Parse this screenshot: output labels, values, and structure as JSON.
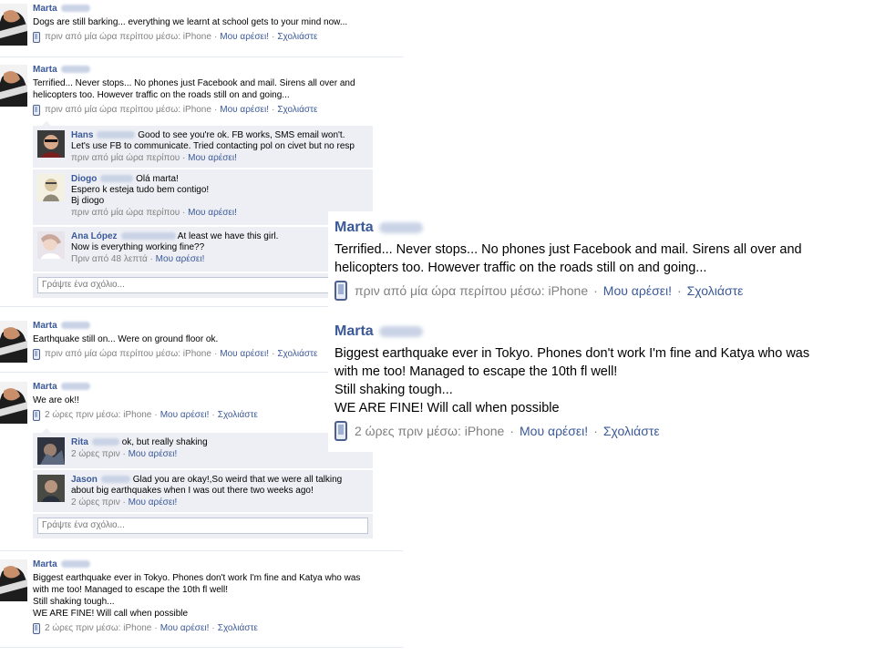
{
  "colors": {
    "link": "#3b5998",
    "meta": "#808080",
    "comment_bg": "#edeff4"
  },
  "feed": {
    "stories": [
      {
        "author": "Marta",
        "text": "Dogs are still barking... everything we learnt at school gets to your mind now...",
        "meta": {
          "time": "πριν από μία ώρα περίπου μέσω: iPhone",
          "like": "Μου αρέσει!",
          "comment": "Σχολιάστε"
        }
      },
      {
        "author": "Marta",
        "text": "Terrified... Never stops... No phones just Facebook and mail. Sirens all over and\nhelicopters too. However traffic on the roads still on and going...",
        "meta": {
          "time": "πριν από μία ώρα περίπου μέσω: iPhone",
          "like": "Μου αρέσει!",
          "comment": "Σχολιάστε"
        },
        "comments": [
          {
            "author": "Hans",
            "text": "Good to see you're ok. FB works, SMS email won't.\nLet's use FB to communicate. Tried contacting pol on civet but no resp",
            "time": "πριν από μία ώρα περίπου",
            "like": "Μου αρέσει!"
          },
          {
            "author": "Diogo",
            "text": "Olá marta!\nEspero k esteja tudo bem contigo!\nBj diogo",
            "time": "πριν από μία ώρα περίπου",
            "like": "Μου αρέσει!"
          },
          {
            "author": "Ana López",
            "text": "At least we have this girl.\nNow is everything working fine??",
            "time": "Πριν από 48 λεπτά",
            "like": "Μου αρέσει!"
          }
        ],
        "write_placeholder": "Γράψτε ένα σχόλιο..."
      },
      {
        "author": "Marta",
        "text": "Earthquake still on... Were on ground floor ok.",
        "meta": {
          "time": "πριν από μία ώρα περίπου μέσω: iPhone",
          "like": "Μου αρέσει!",
          "comment": "Σχολιάστε"
        }
      },
      {
        "author": "Marta",
        "text": "We are ok!!",
        "meta": {
          "time": "2 ώρες πριν μέσω: iPhone",
          "like": "Μου αρέσει!",
          "comment": "Σχολιάστε"
        },
        "comments": [
          {
            "author": "Rita",
            "text": "ok, but really shaking",
            "time": "2 ώρες πριν",
            "like": "Μου αρέσει!"
          },
          {
            "author": "Jason",
            "text": "Glad you are okay!,So weird that we were all talking\nabout big earthquakes when I was out there two weeks ago!",
            "time": "2 ώρες πριν",
            "like": "Μου αρέσει!"
          }
        ],
        "write_placeholder": "Γράψτε ένα σχόλιο..."
      },
      {
        "author": "Marta",
        "text": "Biggest earthquake ever in Tokyo. Phones don't work I'm fine and Katya who was\nwith me too! Managed to escape the 10th fl well!\nStill shaking tough...\nWE ARE FINE! Will call when possible",
        "meta": {
          "time": "2 ώρες πριν μέσω: iPhone",
          "like": "Μου αρέσει!",
          "comment": "Σχολιάστε"
        }
      }
    ]
  },
  "zoom": {
    "posts": [
      {
        "author": "Marta",
        "text": "Terrified... Never stops... No phones just Facebook and mail. Sirens all over and\nhelicopters too. However traffic on the roads still on and going...",
        "meta": {
          "time": "πριν από μία ώρα περίπου μέσω: iPhone",
          "like": "Μου αρέσει!",
          "comment": "Σχολιάστε"
        }
      },
      {
        "author": "Marta",
        "text": "Biggest earthquake ever in Tokyo. Phones don't work I'm fine and Katya who was\nwith me too! Managed to escape the 10th fl well!\nStill shaking tough...\nWE ARE FINE! Will call when possible",
        "meta": {
          "time": "2 ώρες πριν μέσω: iPhone",
          "like": "Μου αρέσει!",
          "comment": "Σχολιάστε"
        }
      }
    ]
  }
}
